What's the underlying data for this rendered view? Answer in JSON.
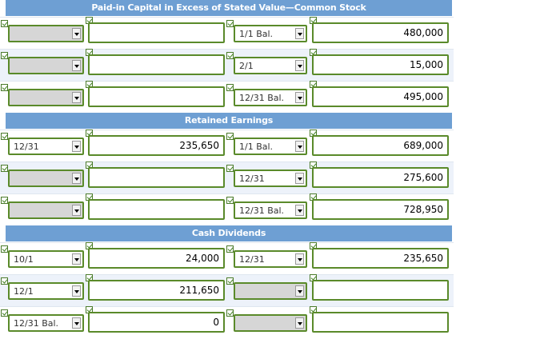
{
  "sections": [
    {
      "title": "Paid-in Capital in Excess of Stated Value—Common Stock",
      "rows": [
        {
          "debit_date": "",
          "debit_amount": "",
          "credit_date": "1/1 Bal.",
          "credit_amount": "480,000"
        },
        {
          "debit_date": "",
          "debit_amount": "",
          "credit_date": "2/1",
          "credit_amount": "15,000"
        },
        {
          "debit_date": "",
          "debit_amount": "",
          "credit_date": "12/31 Bal.",
          "credit_amount": "495,000"
        }
      ]
    },
    {
      "title": "Retained Earnings",
      "rows": [
        {
          "debit_date": "12/31",
          "debit_amount": "235,650",
          "credit_date": "1/1 Bal.",
          "credit_amount": "689,000"
        },
        {
          "debit_date": "",
          "debit_amount": "",
          "credit_date": "12/31",
          "credit_amount": "275,600"
        },
        {
          "debit_date": "",
          "debit_amount": "",
          "credit_date": "12/31 Bal.",
          "credit_amount": "728,950"
        }
      ]
    },
    {
      "title": "Cash Dividends",
      "rows": [
        {
          "debit_date": "10/1",
          "debit_amount": "24,000",
          "credit_date": "12/31",
          "credit_amount": "235,650"
        },
        {
          "debit_date": "12/1",
          "debit_amount": "211,650",
          "credit_date": "",
          "credit_amount": ""
        },
        {
          "debit_date": "12/31 Bal.",
          "debit_amount": "0",
          "credit_date": "",
          "credit_amount": ""
        }
      ]
    }
  ],
  "icons": {
    "check": "checkmark-icon",
    "dropdown": "chevron-down-icon"
  },
  "colors": {
    "header": "#6e9fd3",
    "field_border": "#5a8a2a",
    "empty_select": "#d6d6d6",
    "alt_row": "#edf2fa"
  }
}
